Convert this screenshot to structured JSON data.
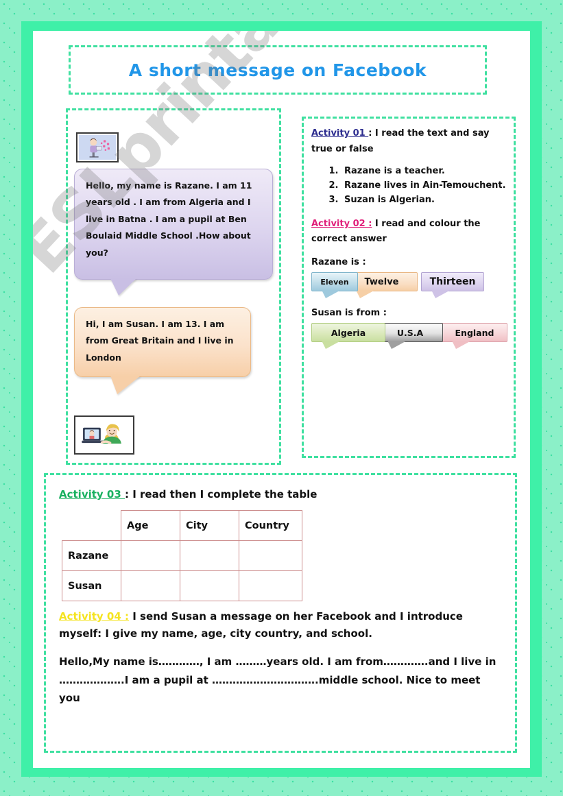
{
  "worksheet": {
    "title": "A short message on Facebook",
    "title_color": "#2196e8"
  },
  "left_panel": {
    "thumb_razane_name": "girl-at-computer-icon",
    "thumb_susan_name": "girl-video-chat-icon",
    "bubble_razane": "Hello, my name is Razane. I am 11 years old . I am from Algeria and I live in Batna . I am a pupil at Ben Boulaid Middle School .How about you?",
    "bubble_susan": "Hi, I am Susan. I am 13. I am from Great Britain and I live in London"
  },
  "activity01": {
    "tag": "Activity 01 ",
    "tag_color": "#2d2d8f",
    "instruction": ": I read the text and say true or false",
    "items": [
      "Razane is a teacher.",
      "Razane lives in Ain-Temouchent.",
      "Suzan is Algerian."
    ]
  },
  "activity02": {
    "tag": "Activity 02 :",
    "tag_color": "#e01f7a",
    "instruction": " I read and colour the correct answer",
    "prompt_1": "Razane is :",
    "options_1": [
      "Eleven",
      "Twelve",
      "Thirteen"
    ],
    "prompt_2": "Susan is from :",
    "options_2": [
      "Algeria",
      "U.S.A",
      "England"
    ]
  },
  "activity03": {
    "tag": "Activity 03 ",
    "tag_color": "#18b05f",
    "instruction": ": I read then I complete the table",
    "table": {
      "headers": [
        "",
        "Age",
        "City",
        "Country"
      ],
      "rows": [
        [
          "Razane",
          "",
          "",
          ""
        ],
        [
          "Susan",
          "",
          "",
          ""
        ]
      ]
    }
  },
  "activity04": {
    "tag": "Activity 04 :",
    "tag_color": "#f5e420",
    "instruction": " I send Susan a message on her Facebook and I introduce myself: I give my name, age, city country, and school.",
    "template_text": "Hello,My name is…………, I am ………years old. I am from………….and I live in ……………….I am a pupil at ………………………….middle school. Nice to meet you"
  },
  "watermark": {
    "text": "ESLprintables.com"
  }
}
